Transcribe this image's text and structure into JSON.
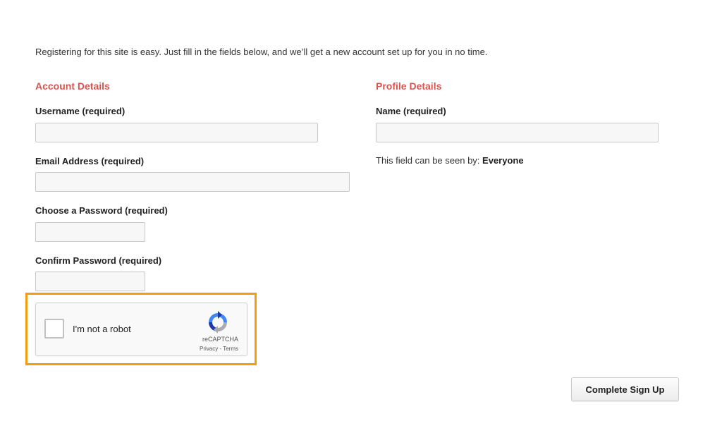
{
  "intro_text": "Registering for this site is easy. Just fill in the fields below, and we’ll get a new account set up for you in no time.",
  "account": {
    "heading": "Account Details",
    "username_label": "Username (required)",
    "username_value": "",
    "email_label": "Email Address (required)",
    "email_value": "",
    "password_label": "Choose a Password (required)",
    "password_value": "",
    "confirm_label": "Confirm Password (required)",
    "confirm_value": ""
  },
  "profile": {
    "heading": "Profile Details",
    "name_label": "Name (required)",
    "name_value": "",
    "visibility_prefix": "This field can be seen by: ",
    "visibility_value": "Everyone"
  },
  "recaptcha": {
    "label": "I'm not a robot",
    "brand": "reCAPTCHA",
    "privacy": "Privacy",
    "separator": " - ",
    "terms": "Terms",
    "checked": false
  },
  "submit_label": "Complete Sign Up",
  "colors": {
    "heading": "#d9534f",
    "highlight": "#f39c12",
    "recaptcha_blue": "#1c3aa9",
    "recaptcha_light_blue": "#4285f4",
    "recaptcha_gray": "#ababab"
  }
}
